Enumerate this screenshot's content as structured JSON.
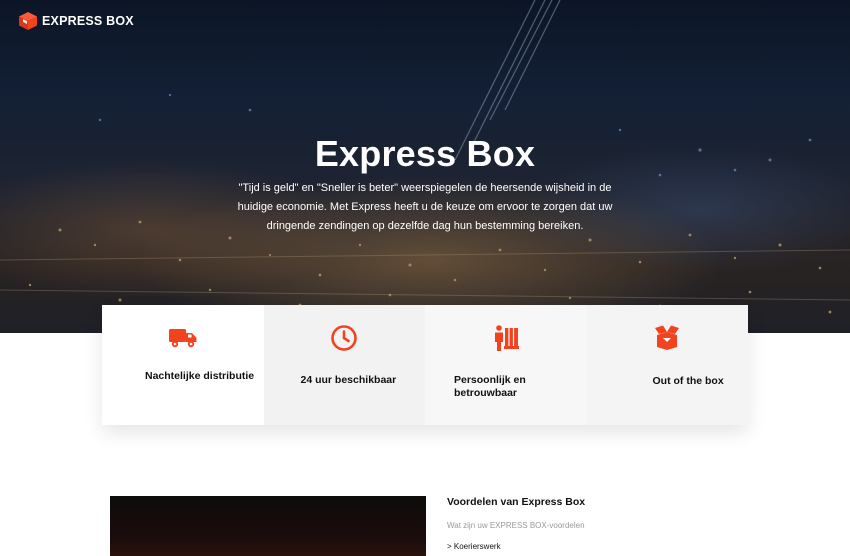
{
  "brand": {
    "name": "EXPRESS BOX",
    "icon": "box-logo-icon",
    "accent": "#f2431e"
  },
  "hero": {
    "title": "Express Box",
    "subtitle": "\"Tijd is geld\" en \"Sneller is beter\" weerspiegelen de heersende wijsheid in de huidige economie. Met Express heeft u de keuze om ervoor te zorgen dat uw dringende zendingen op dezelfde dag hun bestemming bereiken."
  },
  "features": [
    {
      "label": "Nachtelijke distributie",
      "icon": "truck-icon"
    },
    {
      "label": "24 uur beschikbaar",
      "icon": "clock-icon"
    },
    {
      "label": "Persoonlijk en betrouwbaar",
      "icon": "delivery-person-icon"
    },
    {
      "label": "Out of the box",
      "icon": "open-box-icon"
    }
  ],
  "advantages": {
    "title": "Voordelen van Express Box",
    "subtitle": "Wat zijn uw EXPRESS BOX-voordelen",
    "link": "> Koerierswerk"
  }
}
